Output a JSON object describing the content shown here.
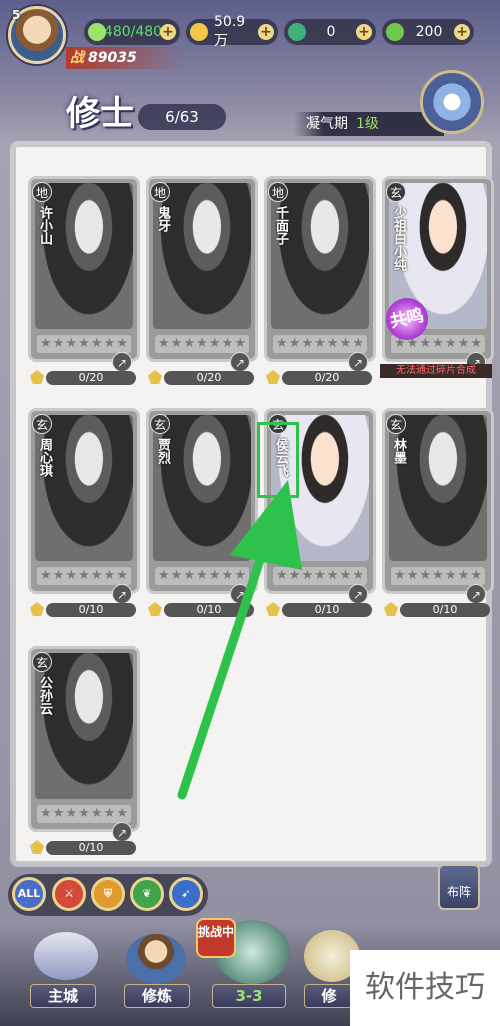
{
  "player": {
    "level": "5",
    "power_label": "战",
    "power": "89035"
  },
  "resources": [
    {
      "name": "stamina",
      "value": "480/480",
      "icon": "peach-icon",
      "color": "#58e06a"
    },
    {
      "name": "coins",
      "value": "50.9万",
      "icon": "coin-icon"
    },
    {
      "name": "jade",
      "value": "0",
      "icon": "jade-icon"
    },
    {
      "name": "leaf",
      "value": "200",
      "icon": "leaf-icon"
    }
  ],
  "header": {
    "title": "修士",
    "count": "6/63",
    "stage": "凝气期",
    "stage_level": "1级"
  },
  "cards": [
    {
      "rank": "地",
      "name": "许小山",
      "progress": "0/20",
      "stars": 7
    },
    {
      "rank": "地",
      "name": "鬼牙",
      "progress": "0/20",
      "stars": 7
    },
    {
      "rank": "地",
      "name": "千面子",
      "progress": "0/20",
      "stars": 7
    },
    {
      "rank": "玄",
      "name": "少祖白小纯",
      "progress": "",
      "stars": 7,
      "note": "无法通过碎片合成",
      "badge": "共鸣"
    },
    {
      "rank": "玄",
      "name": "周心琪",
      "progress": "0/10",
      "stars": 7
    },
    {
      "rank": "玄",
      "name": "贾烈",
      "progress": "0/10",
      "stars": 7
    },
    {
      "rank": "玄",
      "name": "侯云飞",
      "progress": "0/10",
      "stars": 7
    },
    {
      "rank": "玄",
      "name": "林墨",
      "progress": "0/10",
      "stars": 7
    },
    {
      "rank": "玄",
      "name": "公孙云",
      "progress": "0/10",
      "stars": 7
    }
  ],
  "filters": [
    {
      "label": "ALL",
      "color": "#4a6fc9"
    },
    {
      "label": "",
      "icon": "sword-icon",
      "color": "#d3493a"
    },
    {
      "label": "",
      "icon": "shield-icon",
      "color": "#e09a2e"
    },
    {
      "label": "",
      "icon": "leaf-icon",
      "color": "#3fa44a"
    },
    {
      "label": "",
      "icon": "arrow-icon",
      "color": "#3a6ec9"
    }
  ],
  "layout_button": "布阵",
  "nav": [
    {
      "label": "主城"
    },
    {
      "label": "修炼"
    },
    {
      "label": "3-3",
      "badge": "挑战中"
    },
    {
      "label": "修"
    }
  ],
  "watermark": "软件技巧"
}
